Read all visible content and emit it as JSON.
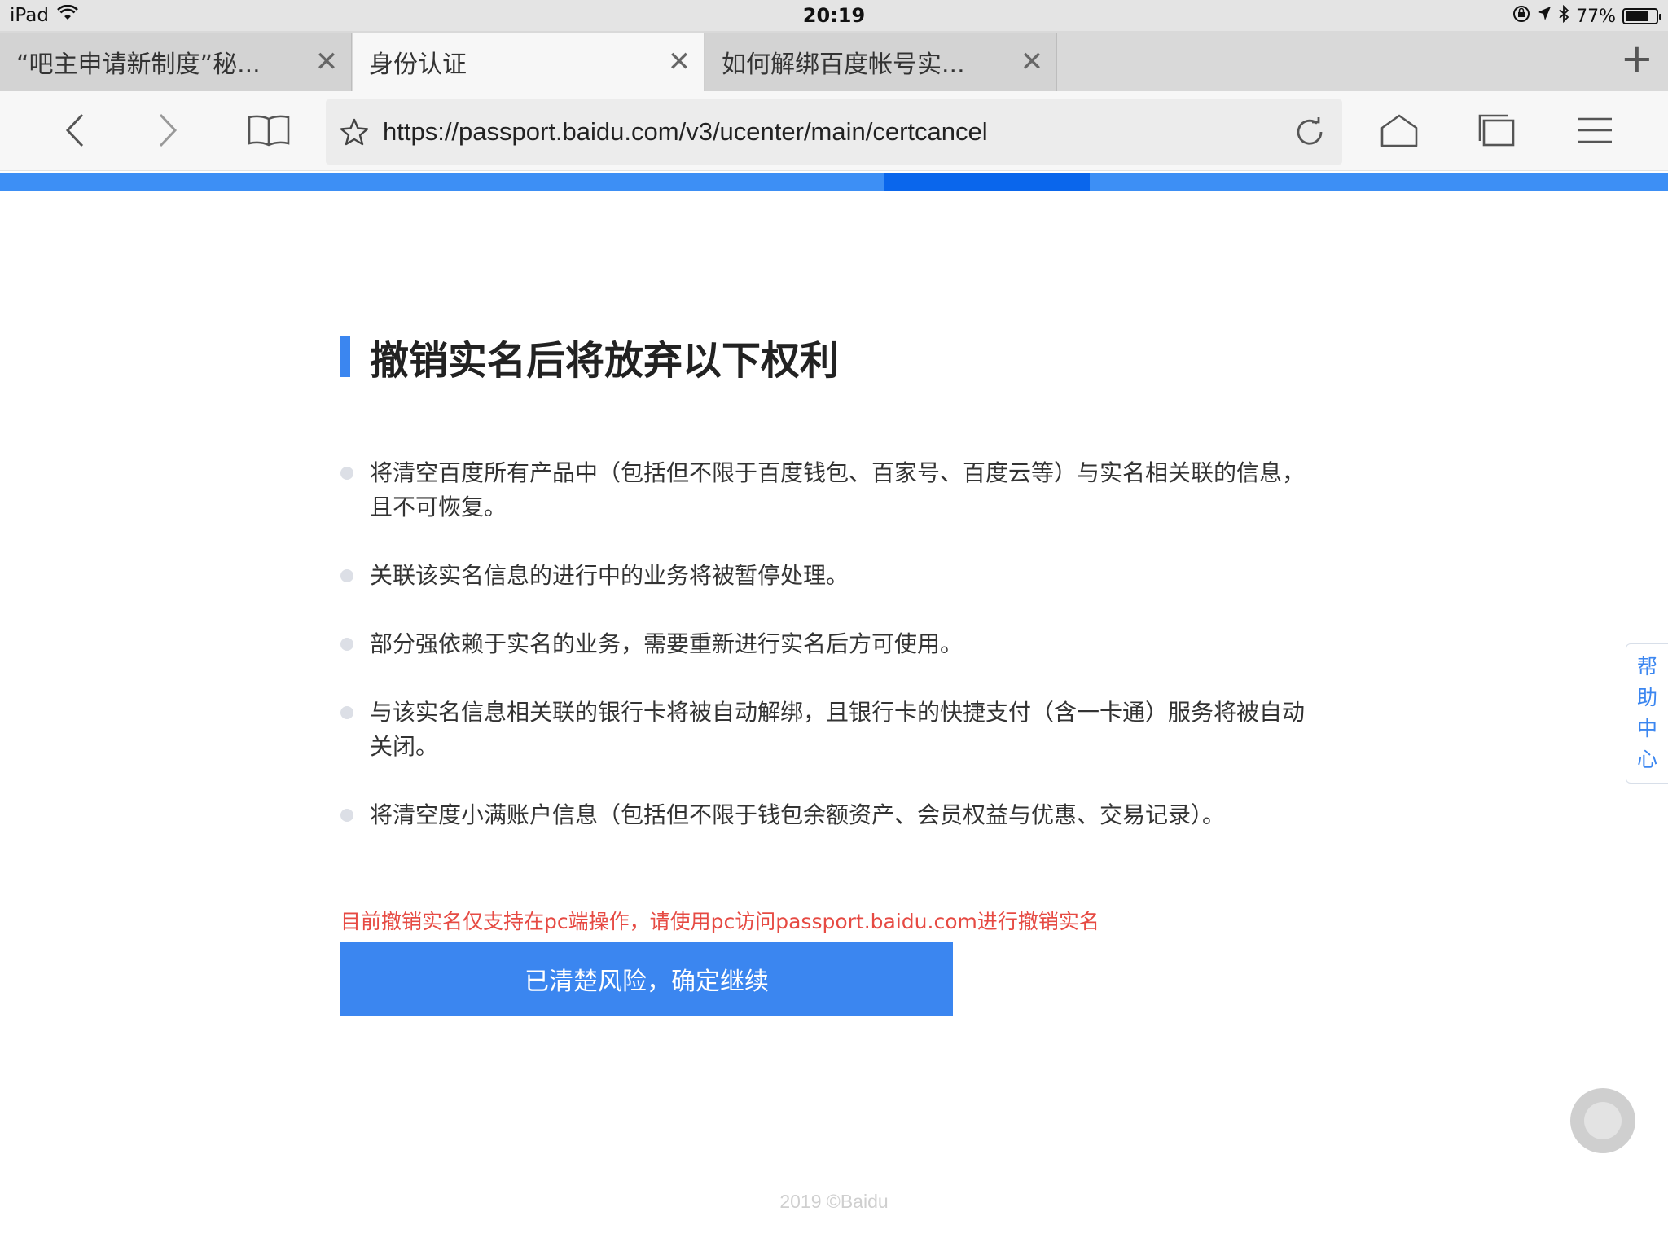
{
  "status_bar": {
    "device": "iPad",
    "time": "20:19",
    "battery": "77%",
    "battery_level": 0.77,
    "icons": [
      "wifi-icon",
      "lock-rotation-icon",
      "location-icon",
      "bluetooth-icon",
      "battery-icon"
    ]
  },
  "tabs": [
    {
      "title": "“吧主申请新制度”秘...",
      "active": false
    },
    {
      "title": "身份认证",
      "active": true
    },
    {
      "title": "如何解绑百度帐号实...",
      "active": false
    }
  ],
  "tab_close_glyph": "✕",
  "tab_new_glyph": "+",
  "toolbar": {
    "url": "https://passport.baidu.com/v3/ucenter/main/certcancel",
    "icons": [
      "back-icon",
      "forward-icon",
      "bookmarks-icon",
      "star-icon",
      "reload-icon",
      "home-icon",
      "tabs-icon",
      "menu-icon"
    ]
  },
  "main": {
    "heading": "撤销实名后将放弃以下权利",
    "items": [
      "将清空百度所有产品中（包括但不限于百度钱包、百家号、百度云等）与实名相关联的信息，且不可恢复。",
      "关联该实名信息的进行中的业务将被暂停处理。",
      "部分强依赖于实名的业务，需要重新进行实名后方可使用。",
      "与该实名信息相关联的银行卡将被自动解绑，且银行卡的快捷支付（含一卡通）服务将被自动关闭。",
      "将清空度小满账户信息（包括但不限于钱包余额资产、会员权益与优惠、交易记录）。"
    ],
    "notice": "目前撤销实名仅支持在pc端操作，请使用pc访问passport.baidu.com进行撤销实名",
    "confirm_button": "已清楚风险，确定继续"
  },
  "help": {
    "chars": [
      "帮",
      "助",
      "中",
      "心"
    ]
  },
  "footer": "2019 ©Baidu",
  "colors": {
    "accent": "#3b86f0",
    "notice": "#e64a43",
    "progress": "#3d8ff5"
  }
}
